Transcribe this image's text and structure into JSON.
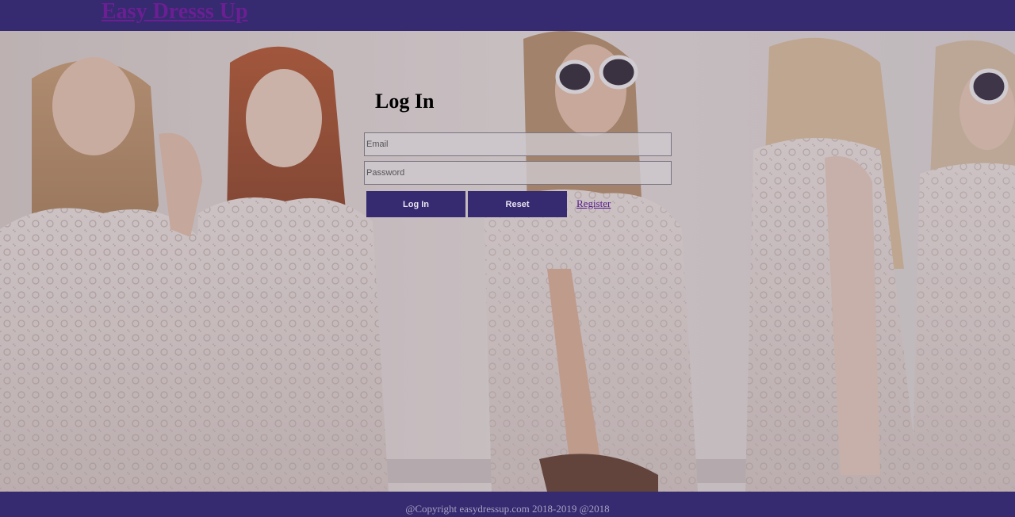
{
  "header": {
    "site_title": "Easy Dresss Up"
  },
  "login": {
    "title": "Log In",
    "email_placeholder": "Email",
    "password_placeholder": "Password",
    "login_label": "Log In",
    "reset_label": "Reset",
    "register_label": "Register"
  },
  "footer": {
    "copyright": "@Copyright easydressup.com 2018-2019 @2018"
  },
  "colors": {
    "brand": "#362a70",
    "link": "#551a8b"
  }
}
